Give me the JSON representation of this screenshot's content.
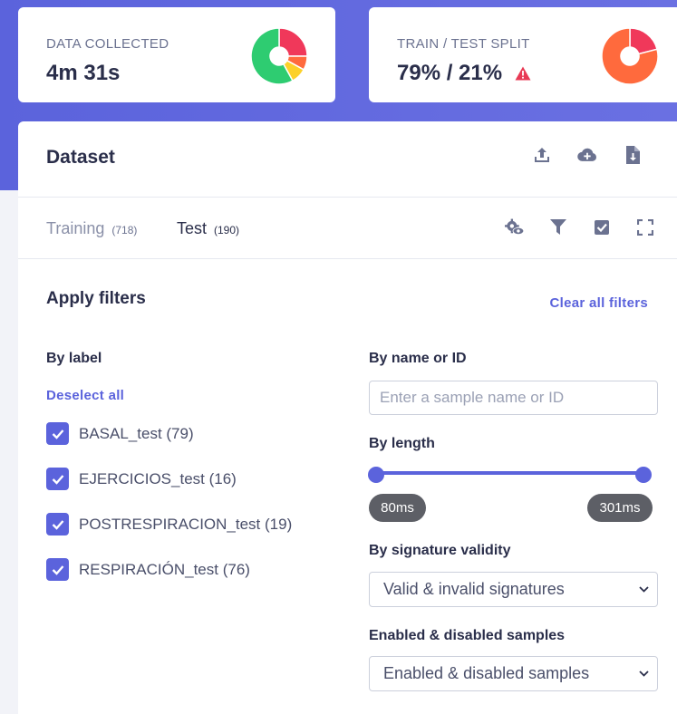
{
  "stats": {
    "data_collected": {
      "label": "DATA COLLECTED",
      "value": "4m 31s",
      "donut": [
        {
          "share": 0.25,
          "color": "#f0385a"
        },
        {
          "share": 0.08,
          "color": "#ff6a3d"
        },
        {
          "share": 0.09,
          "color": "#fcd12a"
        },
        {
          "share": 0.58,
          "color": "#2ecc71"
        }
      ]
    },
    "train_test_split": {
      "label": "TRAIN / TEST SPLIT",
      "value": "79% / 21%",
      "warning_icon": "warning-triangle-icon",
      "warning_color": "#e83a55",
      "donut": [
        {
          "share": 0.21,
          "color": "#f0385a"
        },
        {
          "share": 0.79,
          "color": "#ff6a3d"
        }
      ]
    }
  },
  "dataset": {
    "title": "Dataset",
    "header_icons": [
      "upload-icon",
      "cloud-add-icon",
      "file-download-icon"
    ],
    "tabs": [
      {
        "label": "Training",
        "count": "(718)",
        "active": false
      },
      {
        "label": "Test",
        "count": "(190)",
        "active": true
      }
    ],
    "tool_icons": [
      "settings-eye-icon",
      "filter-icon",
      "select-check-icon",
      "fullscreen-icon"
    ]
  },
  "filters": {
    "title": "Apply filters",
    "clear_all": "Clear all filters",
    "by_label": {
      "heading": "By label",
      "deselect_all": "Deselect all",
      "items": [
        {
          "label": "BASAL_test (79)",
          "checked": true
        },
        {
          "label": "EJERCICIOS_test (16)",
          "checked": true
        },
        {
          "label": "POSTRESPIRACION_test (19)",
          "checked": true
        },
        {
          "label": "RESPIRACIÓN_test (76)",
          "checked": true
        }
      ]
    },
    "by_name": {
      "heading": "By name or ID",
      "value": "",
      "placeholder": "Enter a sample name or ID"
    },
    "by_length": {
      "heading": "By length",
      "min": "80ms",
      "max": "301ms"
    },
    "by_signature": {
      "heading": "By signature validity",
      "selected": "Valid & invalid signatures"
    },
    "enabled": {
      "heading": "Enabled & disabled samples",
      "selected": "Enabled & disabled samples"
    }
  },
  "colors": {
    "accent": "#5b63dc",
    "text": "#2a2e4a",
    "muted": "#6b7290"
  }
}
